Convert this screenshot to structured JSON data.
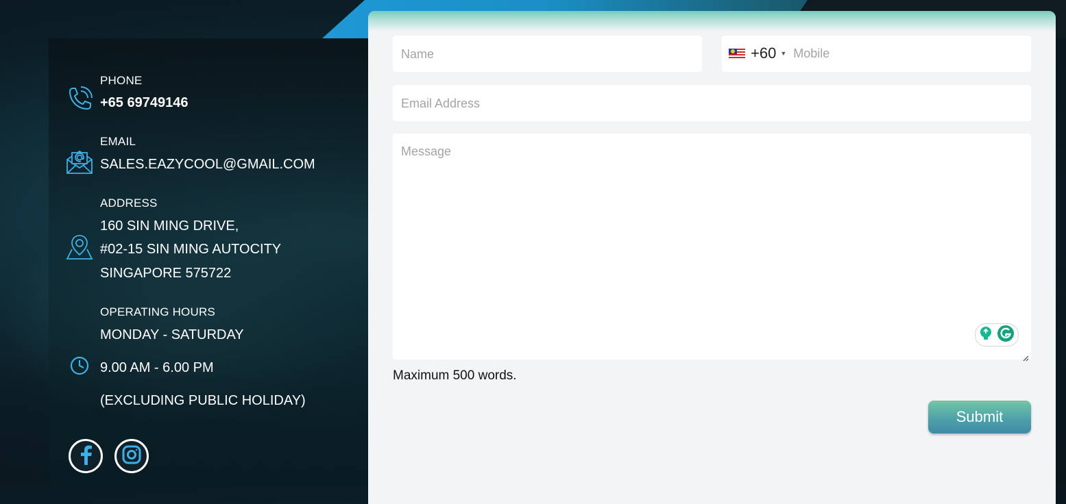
{
  "contact": {
    "phone": {
      "label": "PHONE",
      "value": "+65 69749146",
      "icon": "phone-icon"
    },
    "email": {
      "label": "EMAIL",
      "value": "SALES.EAZYCOOL@GMAIL.COM",
      "icon": "envelope-icon"
    },
    "address": {
      "label": "ADDRESS",
      "lines": [
        "160 SIN MING DRIVE,",
        "#02-15 SIN MING AUTOCITY",
        "SINGAPORE 575722"
      ],
      "icon": "map-pin-icon"
    },
    "hours": {
      "label": "OPERATING HOURS",
      "days": "MONDAY - SATURDAY",
      "time": "9.00 AM - 6.00 PM",
      "note": "(EXCLUDING PUBLIC HOLIDAY)",
      "icon": "clock-icon"
    },
    "social": [
      "facebook-icon",
      "instagram-icon"
    ]
  },
  "form": {
    "name_placeholder": "Name",
    "phone_code": "+60",
    "phone_placeholder": "Mobile",
    "email_placeholder": "Email Address",
    "message_placeholder": "Message",
    "hint": "Maximum 500 words.",
    "submit_label": "Submit"
  },
  "colors": {
    "accent_blue": "#3fb0e6",
    "submit_top": "#73c7a5",
    "submit_bottom": "#3f8aa6",
    "card_bg": "#f3f4f6"
  }
}
